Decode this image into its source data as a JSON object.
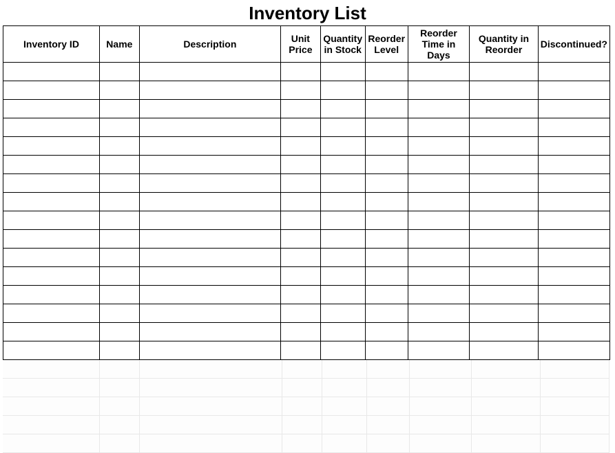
{
  "title": "Inventory List",
  "columns": [
    {
      "label": "Inventory ID",
      "class": "col-id"
    },
    {
      "label": "Name",
      "class": "col-name"
    },
    {
      "label": "Description",
      "class": "col-desc"
    },
    {
      "label": "Unit Price",
      "class": "col-price"
    },
    {
      "label": "Quantity in Stock",
      "class": "col-qty"
    },
    {
      "label": "Reorder Level",
      "class": "col-reorder-level"
    },
    {
      "label": "Reorder Time in Days",
      "class": "col-reorder-time"
    },
    {
      "label": "Quantity in Reorder",
      "class": "col-qty-reorder"
    },
    {
      "label": "Discontinued?",
      "class": "col-disc"
    }
  ],
  "rows": [
    [
      "",
      "",
      "",
      "",
      "",
      "",
      "",
      "",
      ""
    ],
    [
      "",
      "",
      "",
      "",
      "",
      "",
      "",
      "",
      ""
    ],
    [
      "",
      "",
      "",
      "",
      "",
      "",
      "",
      "",
      ""
    ],
    [
      "",
      "",
      "",
      "",
      "",
      "",
      "",
      "",
      ""
    ],
    [
      "",
      "",
      "",
      "",
      "",
      "",
      "",
      "",
      ""
    ],
    [
      "",
      "",
      "",
      "",
      "",
      "",
      "",
      "",
      ""
    ],
    [
      "",
      "",
      "",
      "",
      "",
      "",
      "",
      "",
      ""
    ],
    [
      "",
      "",
      "",
      "",
      "",
      "",
      "",
      "",
      ""
    ],
    [
      "",
      "",
      "",
      "",
      "",
      "",
      "",
      "",
      ""
    ],
    [
      "",
      "",
      "",
      "",
      "",
      "",
      "",
      "",
      ""
    ],
    [
      "",
      "",
      "",
      "",
      "",
      "",
      "",
      "",
      ""
    ],
    [
      "",
      "",
      "",
      "",
      "",
      "",
      "",
      "",
      ""
    ],
    [
      "",
      "",
      "",
      "",
      "",
      "",
      "",
      "",
      ""
    ],
    [
      "",
      "",
      "",
      "",
      "",
      "",
      "",
      "",
      ""
    ],
    [
      "",
      "",
      "",
      "",
      "",
      "",
      "",
      "",
      ""
    ],
    [
      "",
      "",
      "",
      "",
      "",
      "",
      "",
      "",
      ""
    ]
  ],
  "faint_rows": 5,
  "faint_col_widths": [
    141,
    58,
    207,
    58,
    65,
    62,
    90,
    100,
    100
  ]
}
